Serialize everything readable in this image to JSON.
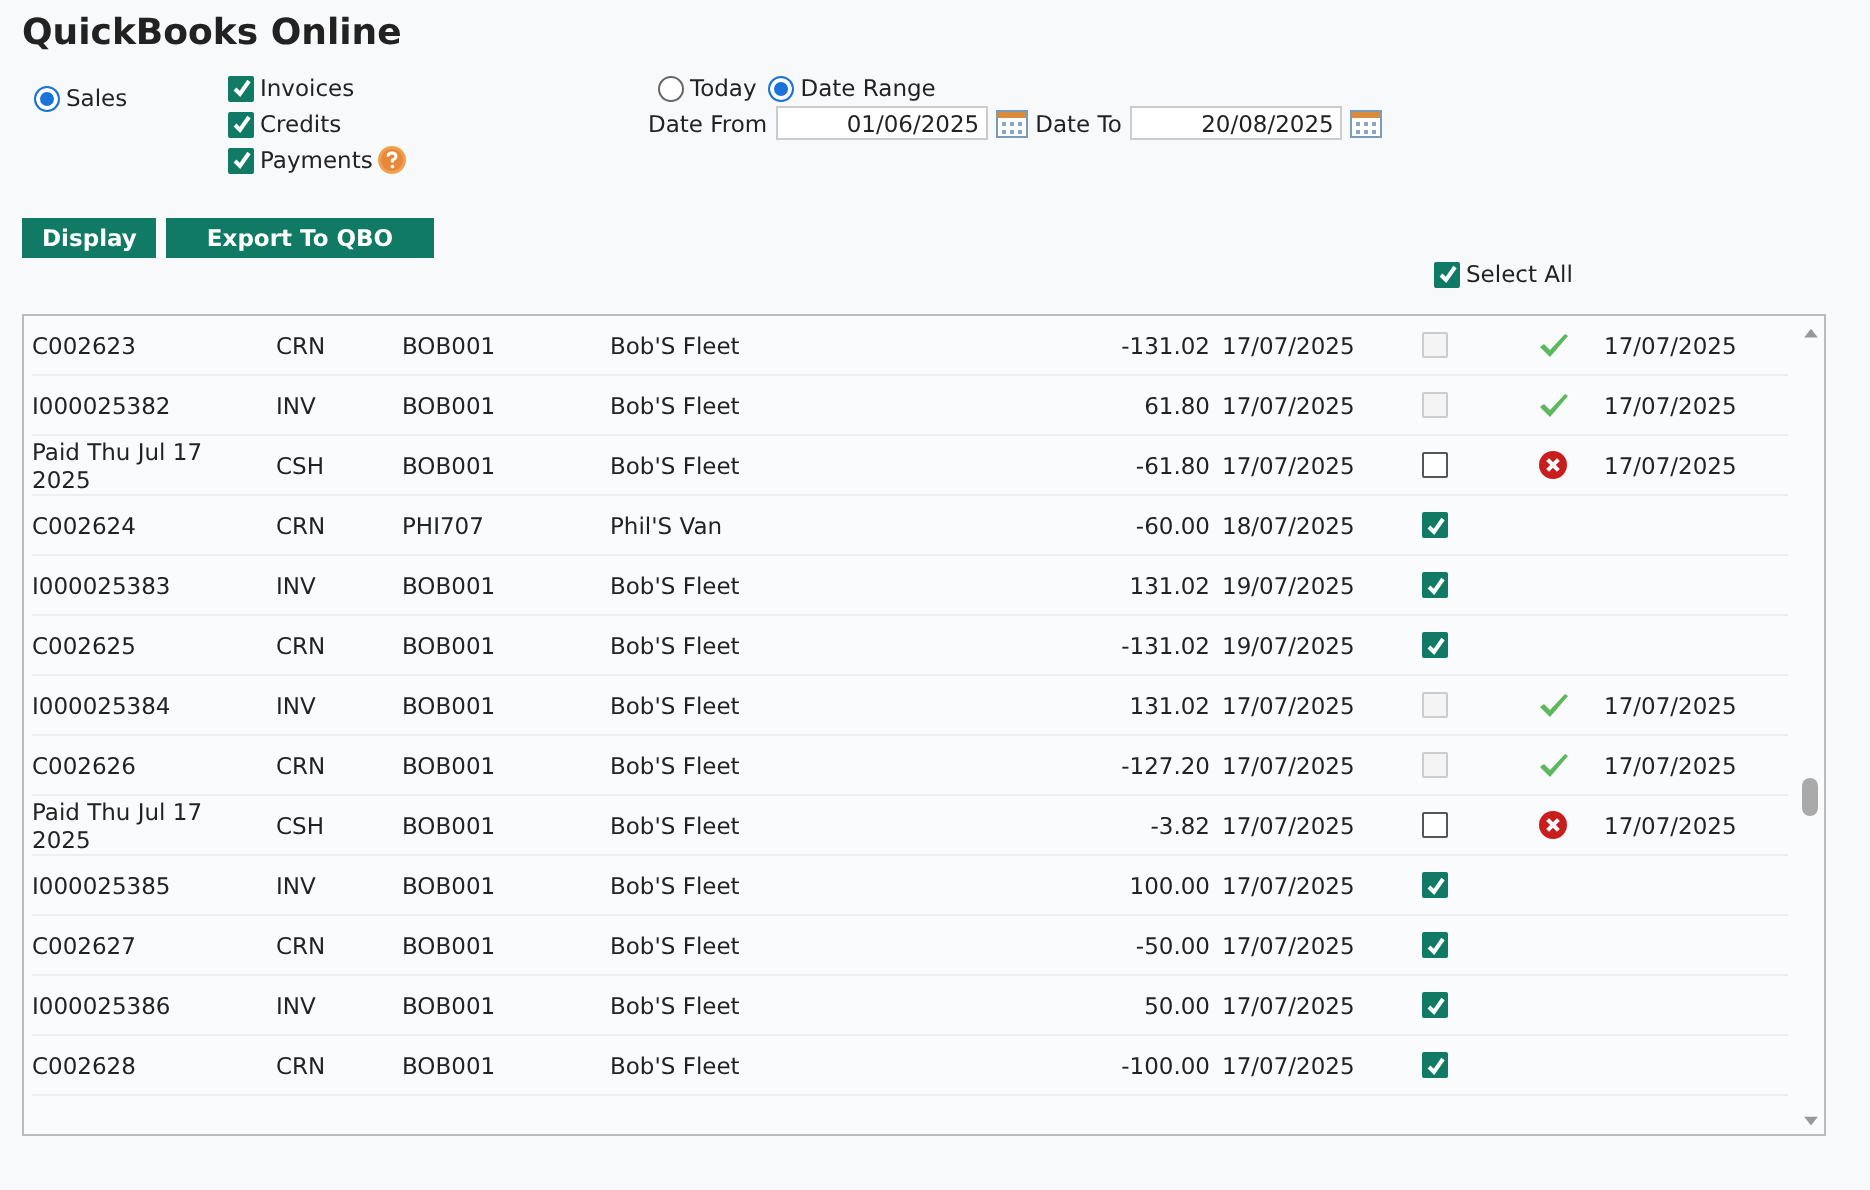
{
  "title": "QuickBooks Online",
  "source": {
    "label": "Sales",
    "selected": true
  },
  "types": [
    {
      "label": "Invoices",
      "checked": true
    },
    {
      "label": "Credits",
      "checked": true
    },
    {
      "label": "Payments",
      "checked": true
    }
  ],
  "range": [
    {
      "label": "Today",
      "selected": false
    },
    {
      "label": "Date Range",
      "selected": true
    }
  ],
  "date_from": {
    "label": "Date From",
    "value": "01/06/2025"
  },
  "date_to": {
    "label": "Date To",
    "value": "20/08/2025"
  },
  "buttons": [
    "Display",
    "Export To QBO"
  ],
  "select_all": {
    "label": "Select All",
    "checked": true
  },
  "rows": [
    {
      "ref": "C002623",
      "type": "CRN",
      "account": "BOB001",
      "name": "Bob'S Fleet",
      "amount": "-131.02",
      "date": "17/07/2025",
      "checked": false,
      "disabled": true,
      "kind": "synced",
      "synced": "17/07/2025"
    },
    {
      "ref": "I000025382",
      "type": "INV",
      "account": "BOB001",
      "name": "Bob'S Fleet",
      "amount": "61.80",
      "date": "17/07/2025",
      "checked": false,
      "disabled": true,
      "kind": "synced",
      "synced": "17/07/2025"
    },
    {
      "ref": "Paid Thu Jul 17 2025",
      "type": "CSH",
      "account": "BOB001",
      "name": "Bob'S Fleet",
      "amount": "-61.80",
      "date": "17/07/2025",
      "checked": false,
      "disabled": false,
      "kind": "failed",
      "synced": "17/07/2025"
    },
    {
      "ref": "C002624",
      "type": "CRN",
      "account": "PHI707",
      "name": "Phil'S Van",
      "amount": "-60.00",
      "date": "18/07/2025",
      "checked": true,
      "disabled": false,
      "kind": "pending"
    },
    {
      "ref": "I000025383",
      "type": "INV",
      "account": "BOB001",
      "name": "Bob'S Fleet",
      "amount": "131.02",
      "date": "19/07/2025",
      "checked": true,
      "disabled": false,
      "kind": "pending"
    },
    {
      "ref": "C002625",
      "type": "CRN",
      "account": "BOB001",
      "name": "Bob'S Fleet",
      "amount": "-131.02",
      "date": "19/07/2025",
      "checked": true,
      "disabled": false,
      "kind": "pending"
    },
    {
      "ref": "I000025384",
      "type": "INV",
      "account": "BOB001",
      "name": "Bob'S Fleet",
      "amount": "131.02",
      "date": "17/07/2025",
      "checked": false,
      "disabled": true,
      "kind": "synced",
      "synced": "17/07/2025"
    },
    {
      "ref": "C002626",
      "type": "CRN",
      "account": "BOB001",
      "name": "Bob'S Fleet",
      "amount": "-127.20",
      "date": "17/07/2025",
      "checked": false,
      "disabled": true,
      "kind": "synced",
      "synced": "17/07/2025"
    },
    {
      "ref": "Paid Thu Jul 17 2025",
      "type": "CSH",
      "account": "BOB001",
      "name": "Bob'S Fleet",
      "amount": "-3.82",
      "date": "17/07/2025",
      "checked": false,
      "disabled": false,
      "kind": "failed",
      "synced": "17/07/2025"
    },
    {
      "ref": "I000025385",
      "type": "INV",
      "account": "BOB001",
      "name": "Bob'S Fleet",
      "amount": "100.00",
      "date": "17/07/2025",
      "checked": true,
      "disabled": false,
      "kind": "pending"
    },
    {
      "ref": "C002627",
      "type": "CRN",
      "account": "BOB001",
      "name": "Bob'S Fleet",
      "amount": "-50.00",
      "date": "17/07/2025",
      "checked": true,
      "disabled": false,
      "kind": "pending"
    },
    {
      "ref": "I000025386",
      "type": "INV",
      "account": "BOB001",
      "name": "Bob'S Fleet",
      "amount": "50.00",
      "date": "17/07/2025",
      "checked": true,
      "disabled": false,
      "kind": "pending"
    },
    {
      "ref": "C002628",
      "type": "CRN",
      "account": "BOB001",
      "name": "Bob'S Fleet",
      "amount": "-100.00",
      "date": "17/07/2025",
      "checked": true,
      "disabled": false,
      "kind": "pending"
    }
  ]
}
